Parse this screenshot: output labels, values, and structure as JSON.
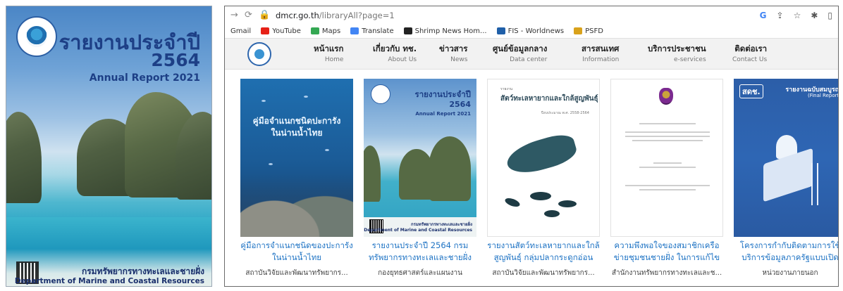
{
  "cover": {
    "title_th": "รายงานประจำปี",
    "year": "2564",
    "subtitle": "Annual Report 2021",
    "org_th": "กรมทรัพยากรทางทะเลและชายฝั่ง",
    "org_en": "Department of Marine and Coastal Resources"
  },
  "browser": {
    "url_host": "dmcr.go.th",
    "url_path": "/libraryAll?page=1",
    "bookmarks": [
      {
        "label": "Gmail",
        "color": "#ffffff"
      },
      {
        "label": "YouTube",
        "color": "#e62117"
      },
      {
        "label": "Maps",
        "color": "#34a853"
      },
      {
        "label": "Translate",
        "color": "#4285f4"
      },
      {
        "label": "Shrimp News Hom...",
        "color": "#222222"
      },
      {
        "label": "FIS - Worldnews",
        "color": "#1f5fa8"
      },
      {
        "label": "PSFD",
        "color": "#d9a21b"
      }
    ]
  },
  "nav": {
    "items": [
      {
        "th": "หน้าแรก",
        "en": "Home"
      },
      {
        "th": "เกี่ยวกับ ทช.",
        "en": "About Us"
      },
      {
        "th": "ข่าวสาร",
        "en": "News"
      },
      {
        "th": "ศูนย์ข้อมูลกลาง",
        "en": "Data center"
      },
      {
        "th": "สารสนเทศ",
        "en": "Information"
      },
      {
        "th": "บริการประชาชน",
        "en": "e-services"
      },
      {
        "th": "ติดต่อเรา",
        "en": "Contact Us"
      }
    ]
  },
  "cards": [
    {
      "thumb_text": "คู่มือจำแนกชนิดปะการัง ในน่านน้ำไทย",
      "title_1": "คู่มือการจำแนกชนิดของปะการัง",
      "title_2": "ในน่านน้ำไทย",
      "sub": "สถาบันวิจัยและพัฒนาทรัพยากร..."
    },
    {
      "thumb_a": "รายงานประจำปี",
      "thumb_b": "2564",
      "thumb_c": "Annual Report 2021",
      "thumb_o1": "กรมทรัพยากรทางทะเลและชายฝั่ง",
      "thumb_o2": "Department of Marine and Coastal Resources",
      "title_1": "รายงานประจำปี 2564 กรม",
      "title_2": "ทรัพยากรทางทะเลและชายฝั่ง",
      "sub": "กองยุทธศาสตร์และแผนงาน"
    },
    {
      "thumb_kick": "รายงาน",
      "thumb_title": "สัตว์ทะเลหายากและใกล้สูญพันธุ์",
      "thumb_year": "ปีงบประมาณ พ.ศ. 2558-2564",
      "title_1": "รายงานสัตว์ทะเลหายากและใกล้",
      "title_2": "สูญพันธุ์ กลุ่มปลากระดูกอ่อน",
      "sub": "สถาบันวิจัยและพัฒนาทรัพยากร..."
    },
    {
      "title_1": "ความพึงพอใจของสมาชิกเครือ",
      "title_2": "ข่ายชุมชนชายฝั่ง ในการแก้ไข",
      "sub": "สำนักงานทรัพยากรทางทะเลและช..."
    },
    {
      "thumb_logo": "สดช.",
      "thumb_fr1": "รายงานฉบับสมบูรณ์",
      "thumb_fr2": "(Final Report)",
      "title_1": "โครงการกำกับติดตามการใช้",
      "title_2": "บริการข้อมูลภาครัฐแบบเปิด",
      "sub": "หน่วยงานภายนอก"
    }
  ]
}
